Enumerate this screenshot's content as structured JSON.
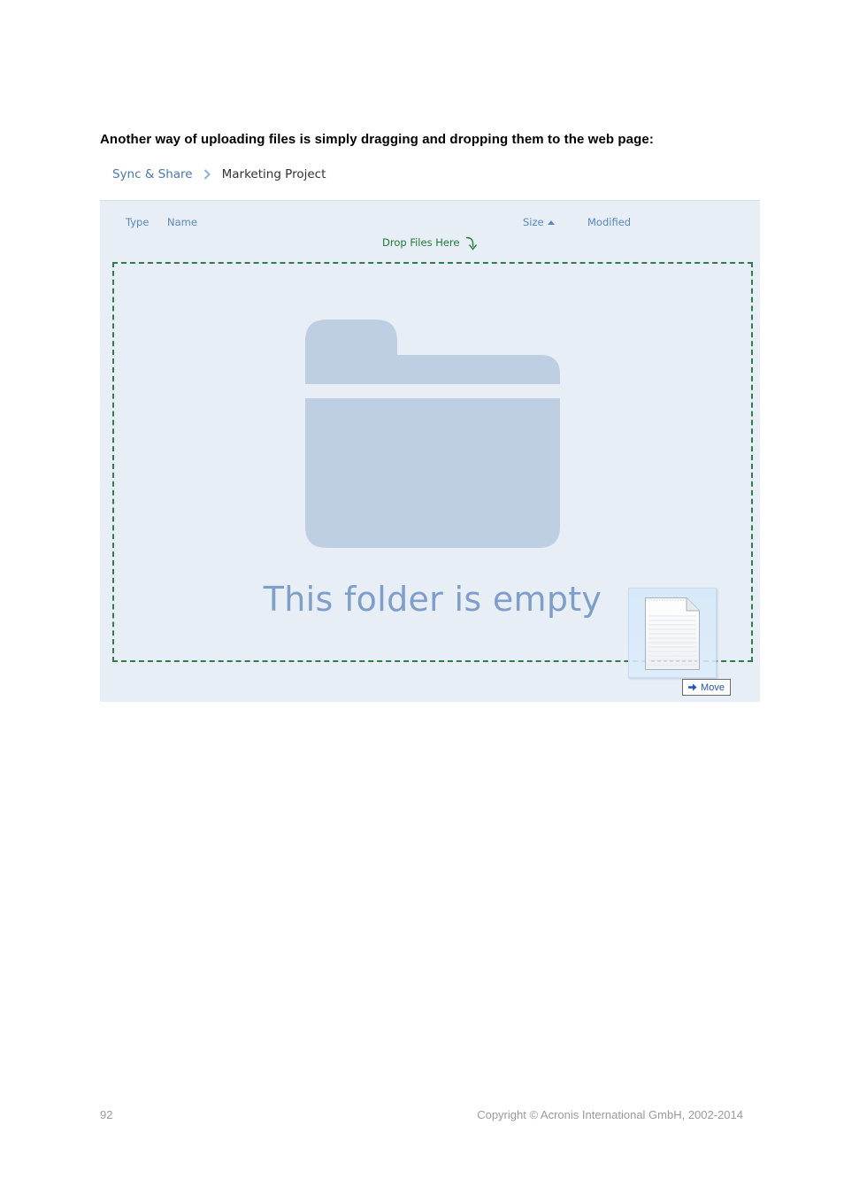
{
  "document": {
    "heading": "Another way of uploading files is simply dragging and dropping them to the web page:"
  },
  "breadcrumb": {
    "root": "Sync & Share",
    "current": "Marketing Project"
  },
  "file_list": {
    "columns": {
      "type": "Type",
      "name": "Name",
      "size": "Size",
      "modified": "Modified"
    },
    "sort_column": "size",
    "sort_direction": "ascending",
    "drop_hint": "Drop Files Here",
    "empty_message": "This folder is empty"
  },
  "drag": {
    "action_label": "Move"
  },
  "footer": {
    "page_number": "92",
    "copyright": "Copyright © Acronis International GmbH, 2002-2014"
  },
  "colors": {
    "link": "#4a78b0",
    "panel_bg": "#e8eef6",
    "drop_border": "#2e7d4a",
    "folder": "#bfcfe3",
    "empty_text": "#7f9fc8"
  }
}
